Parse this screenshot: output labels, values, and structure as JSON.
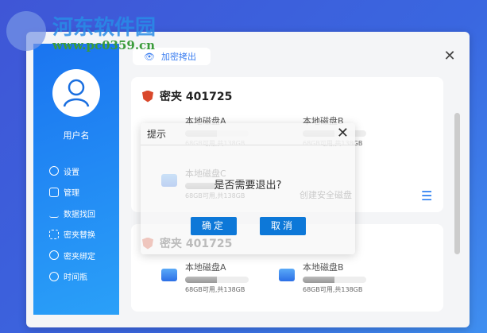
{
  "watermark": {
    "title": "河东软件园",
    "url": "www.pc0359.cn"
  },
  "toolbar": {
    "export_label": "加密拷出"
  },
  "sidebar": {
    "username": "用户名",
    "items": [
      {
        "label": "设置",
        "icon": "gear-icon"
      },
      {
        "label": "管理",
        "icon": "grid-icon"
      },
      {
        "label": "数据找回",
        "icon": "chart-icon"
      },
      {
        "label": "密夹替换",
        "icon": "swap-icon"
      },
      {
        "label": "密夹绑定",
        "icon": "link-icon"
      },
      {
        "label": "时间瓶",
        "icon": "clock-icon"
      }
    ]
  },
  "cards": [
    {
      "title": "密夹 401725",
      "disks": [
        {
          "name": "本地磁盘A",
          "usage": 0.5,
          "caption": "68GB可用,共138GB"
        },
        {
          "name": "本地磁盘B",
          "usage": 0.5,
          "caption": "68GB可用,共138GB"
        },
        {
          "name": "本地磁盘C",
          "usage": 0.5,
          "caption": "68GB可用,共138GB"
        }
      ],
      "create": "创建安全磁盘"
    },
    {
      "title": "密夹 401725",
      "disks": [
        {
          "name": "本地磁盘A",
          "usage": 0.5,
          "caption": "68GB可用,共138GB"
        },
        {
          "name": "本地磁盘B",
          "usage": 0.5,
          "caption": "68GB可用,共138GB"
        }
      ]
    }
  ],
  "dialog": {
    "title": "提示",
    "message": "是否需要退出?",
    "confirm": "确定",
    "cancel": "取消"
  },
  "colors": {
    "accent": "#0d78d8",
    "sidebar": "#1a74f0"
  }
}
